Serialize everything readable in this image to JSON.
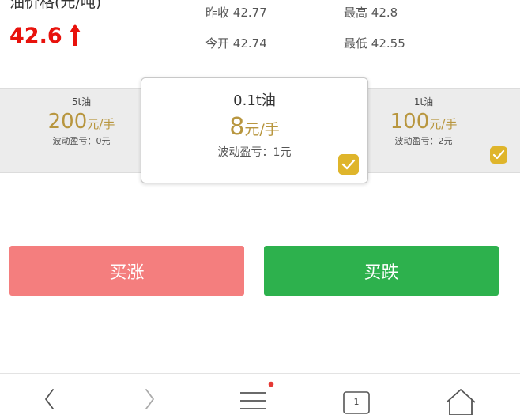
{
  "header": {
    "price_label": "油价格(元/吨)",
    "price_value": "42.6",
    "price_trend": "up",
    "stats": {
      "prev_close_label": "昨收",
      "prev_close_value": "42.77",
      "high_label": "最高",
      "high_value": "42.8",
      "open_label": "今开",
      "open_value": "42.74",
      "low_label": "最低",
      "low_value": "42.55"
    }
  },
  "products": [
    {
      "name": "5t油",
      "price": "200",
      "unit": "元/手",
      "fluct": "波动盈亏：0元",
      "selected": false
    },
    {
      "name": "0.1t油",
      "price": "8",
      "unit": "元/手",
      "fluct": "波动盈亏：1元",
      "selected": true
    },
    {
      "name": "1t油",
      "price": "100",
      "unit": "元/手",
      "fluct": "波动盈亏：2元",
      "selected": false
    }
  ],
  "actions": {
    "buy_up": "买涨",
    "buy_down": "买跌"
  },
  "browser_nav": {
    "tab_count": "1",
    "menu_has_notification": true,
    "icons": [
      "back-icon",
      "forward-icon",
      "menu-icon",
      "tabs-icon",
      "home-icon"
    ]
  },
  "colors": {
    "price_red": "#e8120c",
    "gold": "#b8963f",
    "check_yellow": "#dfb52b",
    "buy_up_bg": "#f47e7e",
    "buy_down_bg": "#2db14d",
    "notification_red": "#e53935"
  }
}
